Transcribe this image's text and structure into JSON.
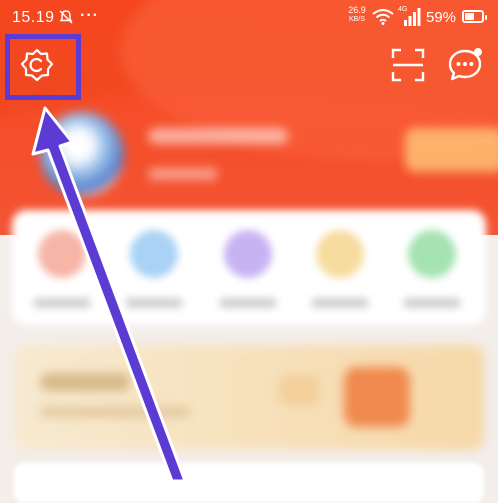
{
  "status_bar": {
    "time": "15.19",
    "more": "···",
    "net_speed_value": "26.9",
    "net_speed_unit": "KB/S",
    "signal_type": "4G",
    "battery_percent": "59%",
    "battery_level": 0.59
  },
  "header": {
    "icons": [
      "settings-icon",
      "scan-icon",
      "message-icon"
    ]
  },
  "annotation": {
    "arrow_color": "#5b3bd4",
    "highlight_color": "#5b3bd4"
  },
  "colors": {
    "header": "#f5461f"
  }
}
